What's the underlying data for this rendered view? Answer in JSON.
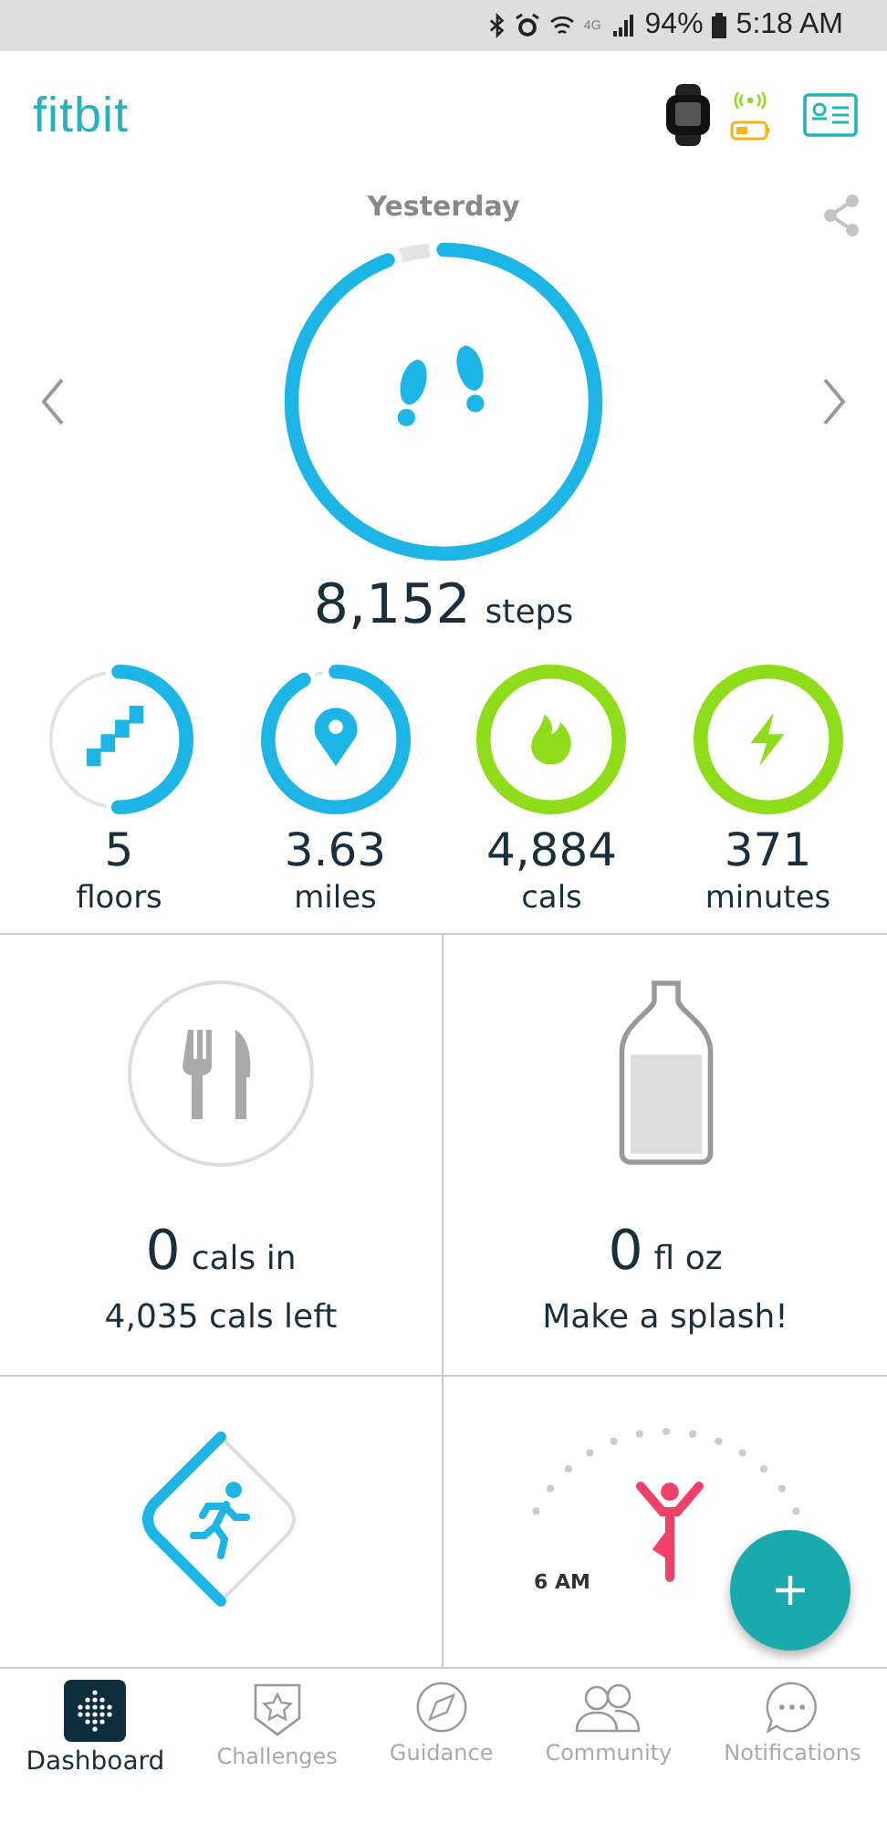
{
  "status_bar": {
    "network": "4G",
    "battery": "94%",
    "time": "5:18 AM"
  },
  "header": {
    "logo": "fitbit"
  },
  "day": {
    "title": "Yesterday"
  },
  "steps": {
    "value": "8,152",
    "unit": "steps",
    "level": 0.94
  },
  "stats": [
    {
      "kind": "floors",
      "value": "5",
      "unit": "floors",
      "level": 0.5,
      "color": "#1cb5e5"
    },
    {
      "kind": "distance",
      "value": "3.63",
      "unit": "miles",
      "level": 0.92,
      "color": "#1cb5e5"
    },
    {
      "kind": "calories",
      "value": "4,884",
      "unit": "cals",
      "level": 1,
      "color": "#8fdd1a"
    },
    {
      "kind": "active",
      "value": "371",
      "unit": "minutes",
      "level": 1,
      "color": "#8fdd1a"
    }
  ],
  "tiles": [
    {
      "kind": "food",
      "value": "0",
      "unit": "cals in",
      "detail": "4,035 cals left"
    },
    {
      "kind": "water",
      "value": "0",
      "unit": "fl oz",
      "detail": "Make a splash!"
    },
    {
      "kind": "exercise"
    },
    {
      "kind": "hourly",
      "time_label": "6 AM"
    }
  ],
  "nav": [
    {
      "kind": "dashboard",
      "label": "Dashboard",
      "selected": true
    },
    {
      "kind": "challenges",
      "label": "Challenges",
      "selected": false
    },
    {
      "kind": "guidance",
      "label": "Guidance",
      "selected": false
    },
    {
      "kind": "community",
      "label": "Community",
      "selected": false
    },
    {
      "kind": "notifications",
      "label": "Notifications",
      "selected": false
    }
  ]
}
